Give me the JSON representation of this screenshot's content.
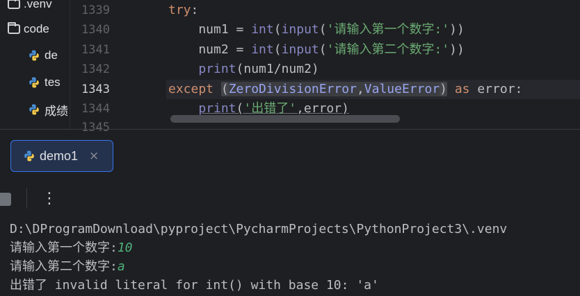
{
  "project": {
    "items": [
      {
        "label": ".venv",
        "icon": "folder-icon"
      },
      {
        "label": "code",
        "icon": "folder-icon"
      },
      {
        "label": "de",
        "icon": "python-file-icon"
      },
      {
        "label": "tes",
        "icon": "python-file-icon"
      },
      {
        "label": "成绩",
        "icon": "python-file-icon"
      }
    ]
  },
  "editor": {
    "line_numbers": [
      "1339",
      "1340",
      "1341",
      "1342",
      "1343",
      "1344",
      "1345"
    ],
    "current_line": "1343",
    "lines": {
      "l1339": {
        "t0": "try",
        "t1": ":"
      },
      "l1340": {
        "t0": "    num1 = ",
        "t1": "int",
        "t2": "(",
        "t3": "input",
        "t4": "(",
        "t5": "'请输入第一个数字:'",
        "t6": "))"
      },
      "l1341": {
        "t0": "    num2 = ",
        "t1": "int",
        "t2": "(",
        "t3": "input",
        "t4": "(",
        "t5": "'请输入第二个数字:'",
        "t6": "))"
      },
      "l1342": {
        "t0": "    ",
        "t1": "print",
        "t2": "(num1/num2)"
      },
      "l1343": {
        "t0": "except ",
        "t1": "(",
        "t2": "ZeroDivisionError",
        "t3": ",",
        "t4": "ValueError",
        "t5": ")",
        "t6": " as ",
        "t7": "error:"
      },
      "l1344": {
        "t0": "    ",
        "t1": "print",
        "t2": "(",
        "t3": "'出错了'",
        "t4": ",error)"
      }
    }
  },
  "run": {
    "tab_label": "demo1",
    "close_glyph": "×",
    "more_glyph": "⋮"
  },
  "console": {
    "line1": "D:\\DProgramDownload\\pyproject\\PycharmProjects\\PythonProject3\\.venv",
    "line2_prompt": "请输入第一个数字:",
    "line2_input": "10",
    "line3_prompt": "请输入第二个数字:",
    "line3_input": "a",
    "line4": "出错了 invalid literal for int() with base 10: 'a'"
  },
  "colors": {
    "background": "#1e1f22",
    "keyword": "#cf8e6d",
    "string": "#6aab73",
    "builtin": "#8888c6",
    "accent": "#3574f0",
    "console_input": "#4fb07a"
  }
}
